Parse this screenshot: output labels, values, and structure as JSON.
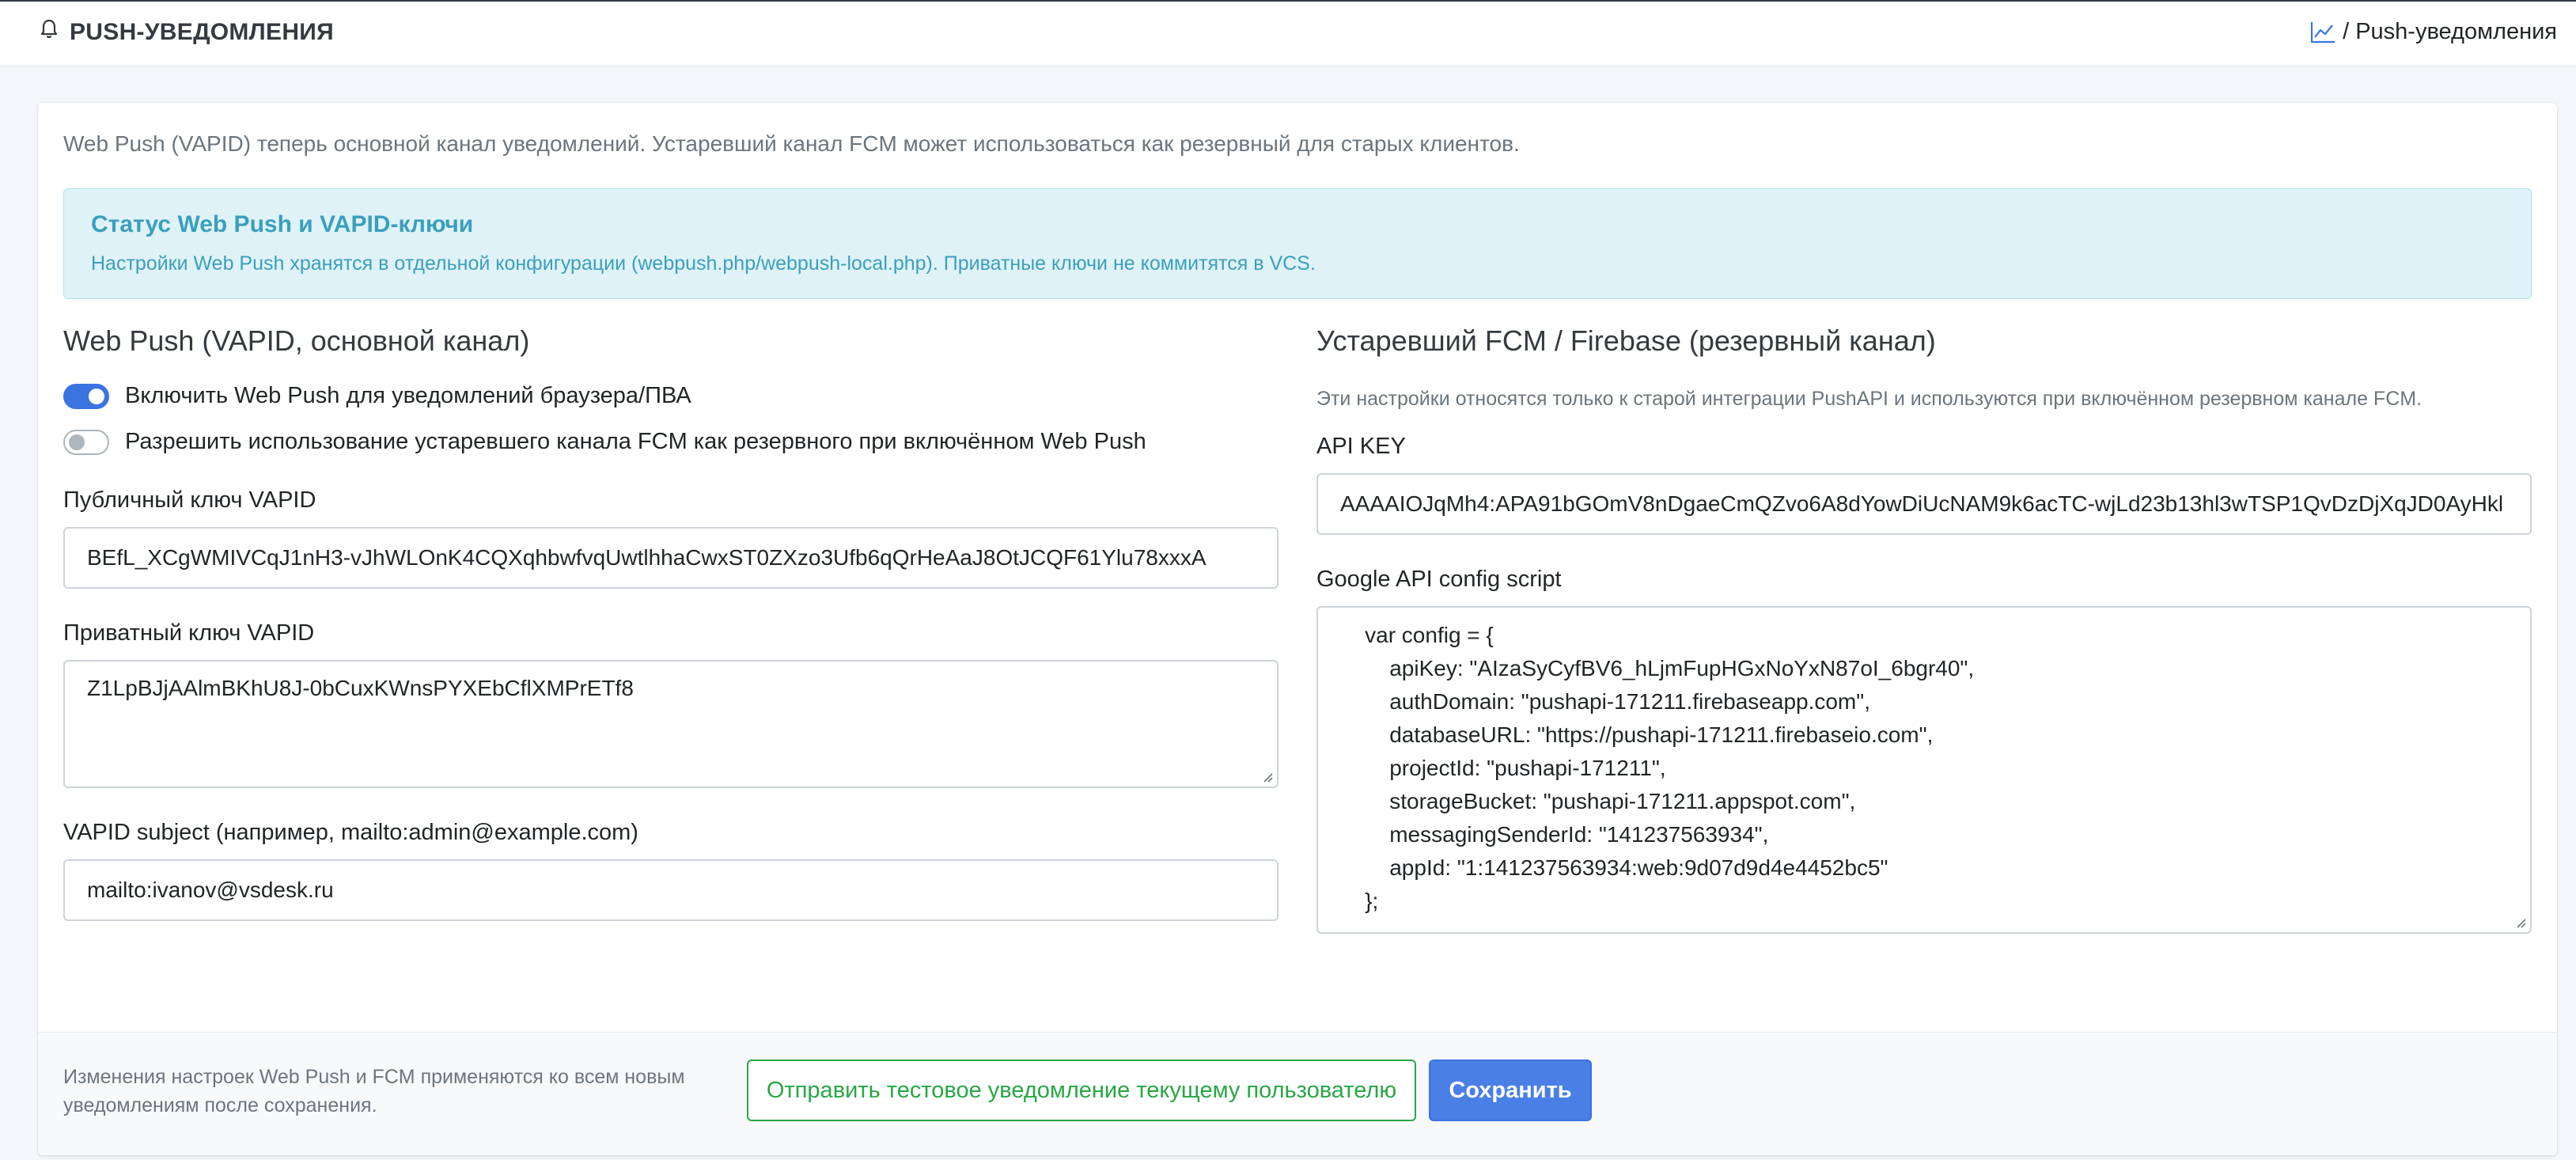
{
  "header": {
    "title": "PUSH-УВЕДОМЛЕНИЯ",
    "breadcrumb_sep": "/",
    "breadcrumb_current": "Push-уведомления"
  },
  "intro": "Web Push (VAPID) теперь основной канал уведомлений. Устаревший канал FCM может использоваться как резервный для старых клиентов.",
  "alert": {
    "title": "Статус Web Push и VAPID-ключи",
    "text": "Настройки Web Push хранятся в отдельной конфигурации (webpush.php/webpush-local.php). Приватные ключи не коммитятся в VCS."
  },
  "webpush": {
    "title": "Web Push (VAPID, основной канал)",
    "enable_label": "Включить Web Push для уведомлений браузера/ПВА",
    "enable_checked": true,
    "fallback_label": "Разрешить использование устаревшего канала FCM как резервного при включённом Web Push",
    "fallback_checked": false,
    "public_key_label": "Публичный ключ VAPID",
    "public_key_value": "BEfL_XCgWMIVCqJ1nH3-vJhWLOnK4CQXqhbwfvqUwtlhhaCwxST0ZXzo3Ufb6qQrHeAaJ8OtJCQF61Ylu78xxxA",
    "private_key_label": "Приватный ключ VAPID",
    "private_key_value": "Z1LpBJjAAlmBKhU8J-0bCuxKWnsPYXEbCflXMPrETf8",
    "subject_label": "VAPID subject (например, mailto:admin@example.com)",
    "subject_value": "mailto:ivanov@vsdesk.ru"
  },
  "fcm": {
    "title": "Устаревший FCM / Firebase (резервный канал)",
    "note": "Эти настройки относятся только к старой интеграции PushAPI и используются при включённом резервном канале FCM.",
    "api_key_label": "API KEY",
    "api_key_value": "AAAAIOJqMh4:APA91bGOmV8nDgaeCmQZvo6A8dYowDiUcNAM9k6acTC-wjLd23b13hl3wTSP1QvDzDjXqJD0AyHkl",
    "config_label": "Google API config script",
    "config_value": "    var config = {\n        apiKey: \"AIzaSyCyfBV6_hLjmFupHGxNoYxN87oI_6bgr40\",\n        authDomain: \"pushapi-171211.firebaseapp.com\",\n        databaseURL: \"https://pushapi-171211.firebaseio.com\",\n        projectId: \"pushapi-171211\",\n        storageBucket: \"pushapi-171211.appspot.com\",\n        messagingSenderId: \"141237563934\",\n        appId: \"1:141237563934:web:9d07d9d4e4452bc5\"\n    };"
  },
  "footer": {
    "note": "Изменения настроек Web Push и FCM применяются ко всем новым уведомлениям после сохранения.",
    "test_button": "Отправить тестовое уведомление текущему пользователю",
    "save_button": "Сохранить"
  },
  "colors": {
    "accent": "#3b73e0",
    "success": "#28a745",
    "info_text": "#3a9fbd",
    "info_bg": "#dff2f7"
  }
}
